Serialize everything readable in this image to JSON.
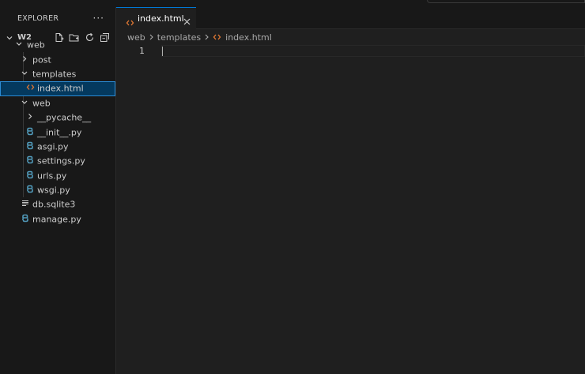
{
  "explorer": {
    "title": "EXPLORER",
    "more_label": "···",
    "project": "W2",
    "actions": [
      "new-file-icon",
      "new-folder-icon",
      "refresh-icon",
      "collapse-all-icon"
    ],
    "tree": [
      {
        "label": "web",
        "type": "folder",
        "expanded": true,
        "depth": 0
      },
      {
        "label": "post",
        "type": "folder",
        "expanded": false,
        "depth": 1
      },
      {
        "label": "templates",
        "type": "folder",
        "expanded": true,
        "depth": 1
      },
      {
        "label": "index.html",
        "type": "html",
        "depth": 2,
        "selected": true
      },
      {
        "label": "web",
        "type": "folder",
        "expanded": true,
        "depth": 1
      },
      {
        "label": "__pycache__",
        "type": "folder",
        "expanded": false,
        "depth": 2
      },
      {
        "label": "__init__.py",
        "type": "python",
        "depth": 2
      },
      {
        "label": "asgi.py",
        "type": "python",
        "depth": 2
      },
      {
        "label": "settings.py",
        "type": "python",
        "depth": 2
      },
      {
        "label": "urls.py",
        "type": "python",
        "depth": 2
      },
      {
        "label": "wsgi.py",
        "type": "python",
        "depth": 2
      },
      {
        "label": "db.sqlite3",
        "type": "file",
        "depth": 1
      },
      {
        "label": "manage.py",
        "type": "python",
        "depth": 1
      }
    ]
  },
  "editor": {
    "tab": {
      "label": "index.html",
      "close_icon": "close-icon"
    },
    "breadcrumb": [
      "web",
      "templates",
      "index.html"
    ],
    "line_numbers": [
      "1"
    ]
  },
  "colors": {
    "accent": "#0078d4",
    "html_icon": "#e37933",
    "python_icon": "#519aba",
    "selection": "#04395e"
  }
}
